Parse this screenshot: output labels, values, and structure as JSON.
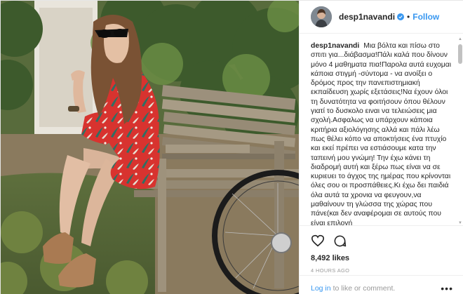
{
  "header": {
    "username": "desp1navandi",
    "separator": "•",
    "follow_label": "Follow"
  },
  "caption": {
    "username": "desp1navandi",
    "text": "Μια βόλτα και πίσω στο σπιτι για...διάβασμα!Πάλι καλά που δίνουν μόνο 4 μαθηματα πια!Παρολα αυτά ευχομαι κάποια στιγμή -σύντομα - να ανοίξει ο δρόμος προς την πανεπιστημιακή εκπαίδευση χωρίς εξετάσεις!Να έχουν όλοι τη δυνατότητα να φοιτήσουν όπου θέλουν γιατί το δυσκολο ειναι να τελειώσεις μια σχολή.Ασφαλως να υπάρχουν κάποια κριτήρια αξιολόγησης αλλά και πάλι λέω πως θέλει κόπο να αποκτήσεις ένα πτυχίο και εκεί πρέπει να εστιάσουμε κατα την ταπεινή μου γνώμη! Την έχω κάνει τη διαδρομή αυτή και ξέρω πως είναι να σε κυριευει το άγχος της ημέρας που κρίνονται όλες σου οι προσπάθειες.Κι έχω δει παιδιά όλα αυτά τα χρονια να φευγουν,να μαθαίνουν τη γλώσσα της χώρας που πάνε(και δεν αναφέρομαι σε αυτούς που είναι επιλογή"
  },
  "actions": {
    "icons": [
      "heart-icon",
      "comment-icon"
    ],
    "likes": "8,492 likes",
    "time_ago": "4 HOURS AGO"
  },
  "footer": {
    "login_link": "Log in",
    "login_text": "to like or comment.",
    "more_label": "•••"
  },
  "colors": {
    "accent": "#3897f0",
    "text": "#262626",
    "muted": "#999999",
    "border": "#efefef"
  }
}
